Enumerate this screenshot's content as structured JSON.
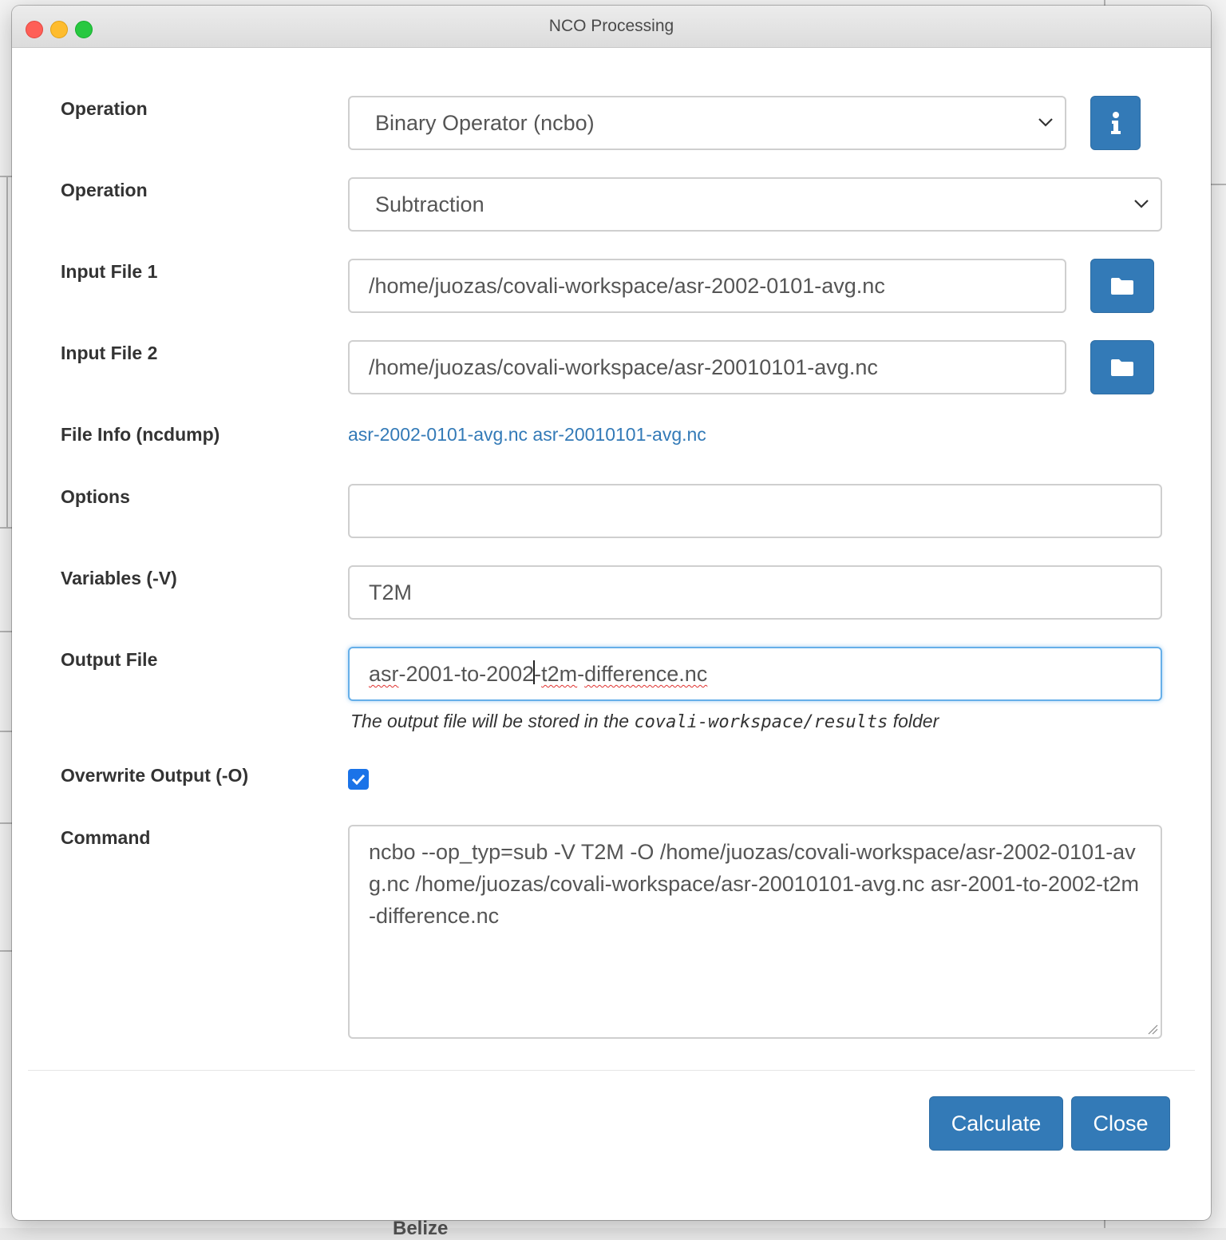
{
  "window": {
    "title": "NCO Processing"
  },
  "form": {
    "operation_label": "Operation",
    "operation_value": "Binary Operator (ncbo)",
    "operation2_label": "Operation",
    "operation2_value": "Subtraction",
    "input1_label": "Input File 1",
    "input1_value": "/home/juozas/covali-workspace/asr-2002-0101-avg.nc",
    "input2_label": "Input File 2",
    "input2_value": "/home/juozas/covali-workspace/asr-20010101-avg.nc",
    "fileinfo_label": "File Info (ncdump)",
    "fileinfo_link1": "asr-2002-0101-avg.nc",
    "fileinfo_link2": "asr-20010101-avg.nc",
    "options_label": "Options",
    "options_value": "",
    "variables_label": "Variables (-V)",
    "variables_value": "T2M",
    "output_label": "Output File",
    "output_value_part1": "asr",
    "output_value_part2": "-2001-to-2002",
    "output_value_part3": "-",
    "output_value_part4": "t2m",
    "output_value_part5": "-",
    "output_value_part6": "difference.nc",
    "output_help_pre": "The output file will be stored in the",
    "output_help_code": "covali-workspace/results",
    "output_help_post": "folder",
    "overwrite_label": "Overwrite Output (-O)",
    "overwrite_checked": true,
    "command_label": "Command",
    "command_value": "ncbo --op_typ=sub  -V T2M -O  /home/juozas/covali-workspace/asr-2002-0101-avg.nc /home/juozas/covali-workspace/asr-20010101-avg.nc asr-2001-to-2002-t2m-difference.nc"
  },
  "footer": {
    "calculate_label": "Calculate",
    "close_label": "Close"
  },
  "background": {
    "map_label": "Belize"
  },
  "icons": {
    "info": "info-icon",
    "folder": "folder-icon",
    "chevron": "chevron-down-icon",
    "check": "checkmark-icon"
  },
  "colors": {
    "primary": "#337ab7",
    "link": "#337ab7",
    "checkbox": "#1a73e8"
  }
}
